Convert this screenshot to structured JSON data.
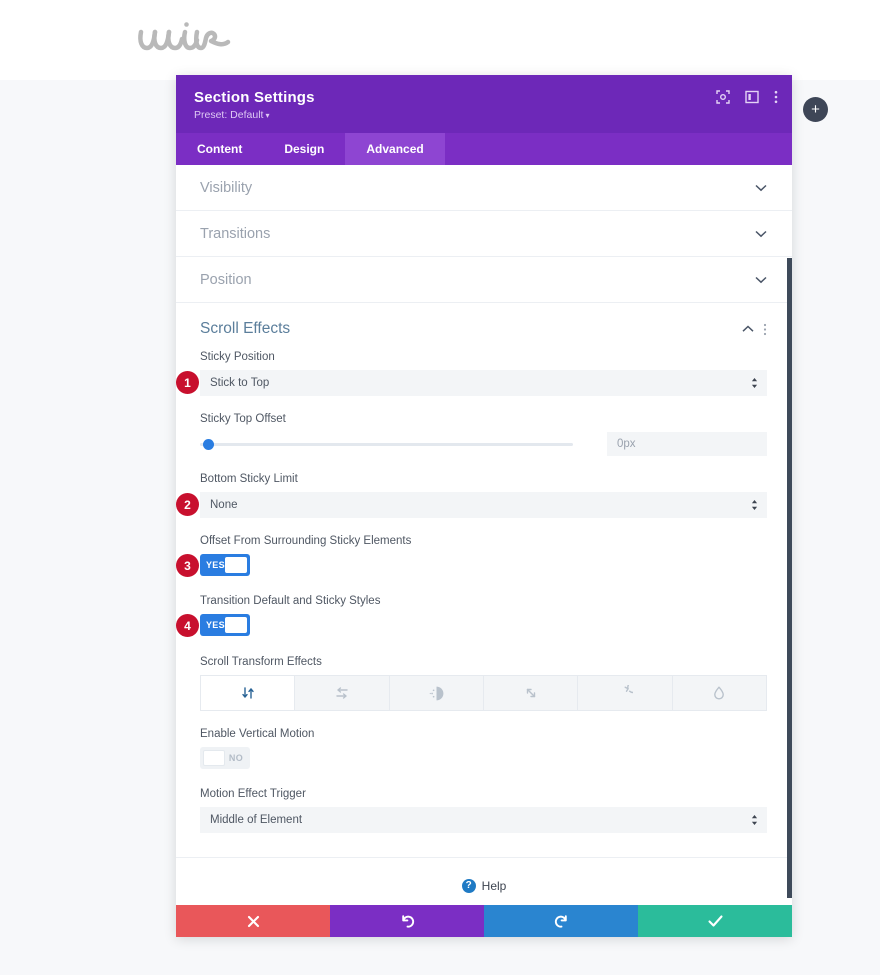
{
  "brand": {
    "logo_text": "wire"
  },
  "canvas": {
    "add_button_label": "+"
  },
  "modal": {
    "title": "Section Settings",
    "preset_label": "Preset: Default",
    "preset_caret": "▾",
    "header_icons": [
      {
        "name": "focus-icon"
      },
      {
        "name": "layout-panel-icon"
      },
      {
        "name": "more-vertical-icon"
      }
    ],
    "tabs": [
      {
        "label": "Content",
        "active": false
      },
      {
        "label": "Design",
        "active": false
      },
      {
        "label": "Advanced",
        "active": true
      }
    ],
    "accordions": [
      {
        "label": "Visibility",
        "open": false,
        "chevron": "down"
      },
      {
        "label": "Transitions",
        "open": false,
        "chevron": "down"
      },
      {
        "label": "Position",
        "open": false,
        "chevron": "down"
      },
      {
        "label": "Scroll Effects",
        "open": true,
        "chevron": "up"
      }
    ],
    "scroll_effects": {
      "sticky_position": {
        "label": "Sticky Position",
        "value": "Stick to Top",
        "badge": "1"
      },
      "sticky_top_offset": {
        "label": "Sticky Top Offset",
        "value": "0px",
        "slider_percent": 0
      },
      "bottom_sticky_limit": {
        "label": "Bottom Sticky Limit",
        "value": "None",
        "badge": "2"
      },
      "offset_surrounding": {
        "label": "Offset From Surrounding Sticky Elements",
        "toggle_value": "YES",
        "badge": "3"
      },
      "transition_styles": {
        "label": "Transition Default and Sticky Styles",
        "toggle_value": "YES",
        "badge": "4"
      },
      "scroll_transform_effects": {
        "label": "Scroll Transform Effects",
        "options": [
          {
            "name": "vertical-motion-icon",
            "active": true
          },
          {
            "name": "horizontal-motion-icon",
            "active": false
          },
          {
            "name": "fade-icon",
            "active": false
          },
          {
            "name": "scale-icon",
            "active": false
          },
          {
            "name": "rotate-icon",
            "active": false
          },
          {
            "name": "blur-icon",
            "active": false
          }
        ]
      },
      "enable_vertical_motion": {
        "label": "Enable Vertical Motion",
        "toggle_value": "NO"
      },
      "motion_effect_trigger": {
        "label": "Motion Effect Trigger",
        "value": "Middle of Element"
      }
    },
    "help": {
      "label": "Help",
      "icon_glyph": "?"
    },
    "footer_buttons": [
      {
        "name": "cancel-button",
        "icon": "close-icon",
        "color": "#e9575a"
      },
      {
        "name": "undo-button",
        "icon": "undo-icon",
        "color": "#7b2ec4"
      },
      {
        "name": "redo-button",
        "icon": "redo-icon",
        "color": "#2a85d0"
      },
      {
        "name": "save-button",
        "icon": "check-icon",
        "color": "#2bbc9b"
      }
    ]
  }
}
